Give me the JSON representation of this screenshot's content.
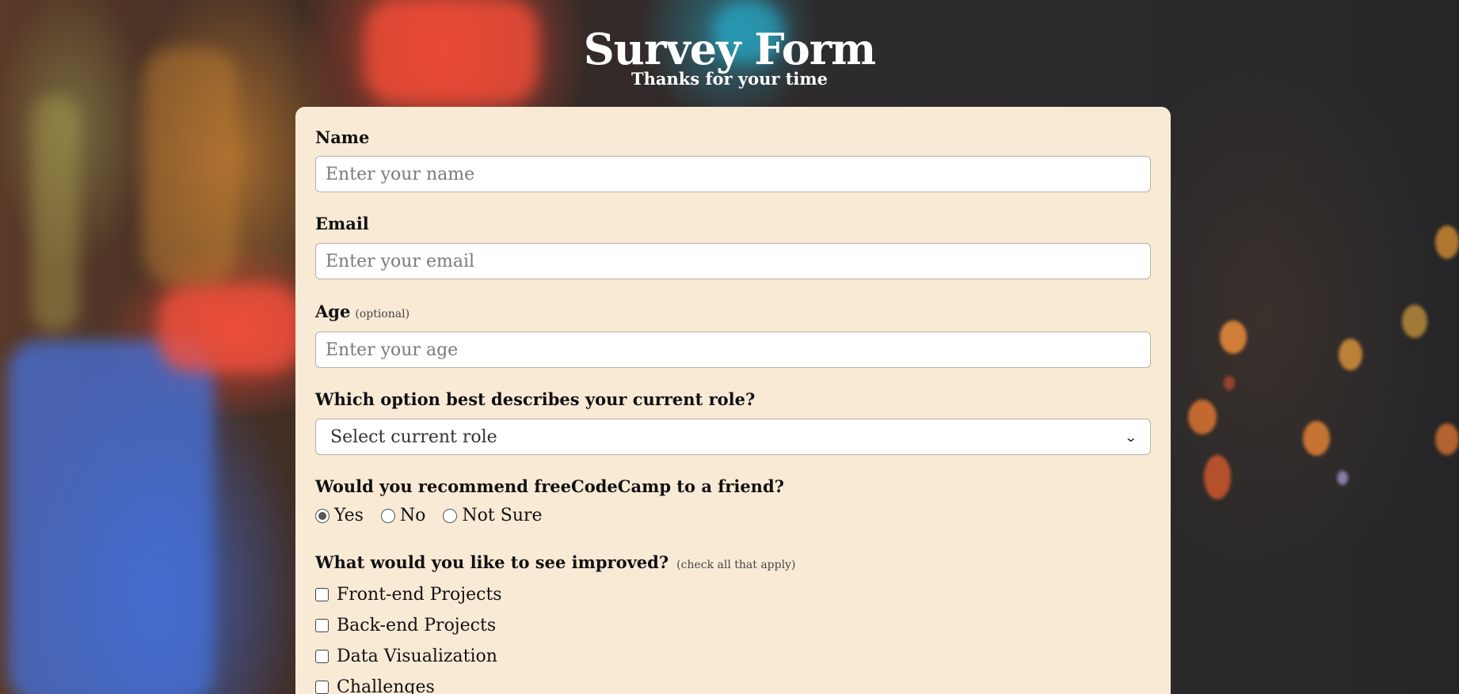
{
  "header": {
    "title": "Survey Form",
    "subtitle": "Thanks for your time"
  },
  "form": {
    "name": {
      "label": "Name",
      "placeholder": "Enter your name",
      "value": ""
    },
    "email": {
      "label": "Email",
      "placeholder": "Enter your email",
      "value": ""
    },
    "age": {
      "label": "Age",
      "hint": "(optional)",
      "placeholder": "Enter your age",
      "value": ""
    },
    "role": {
      "label": "Which option best describes your current role?",
      "selected": "Select current role"
    },
    "recommend": {
      "label": "Would you recommend freeCodeCamp to a friend?",
      "options": [
        "Yes",
        "No",
        "Not Sure"
      ],
      "selected": "Yes"
    },
    "improve": {
      "label": "What would you like to see improved?",
      "hint": "(check all that apply)",
      "options": [
        "Front-end Projects",
        "Back-end Projects",
        "Data Visualization",
        "Challenges"
      ]
    }
  },
  "colors": {
    "card_background": "#f9ead6",
    "header_text": "#ffffff"
  }
}
